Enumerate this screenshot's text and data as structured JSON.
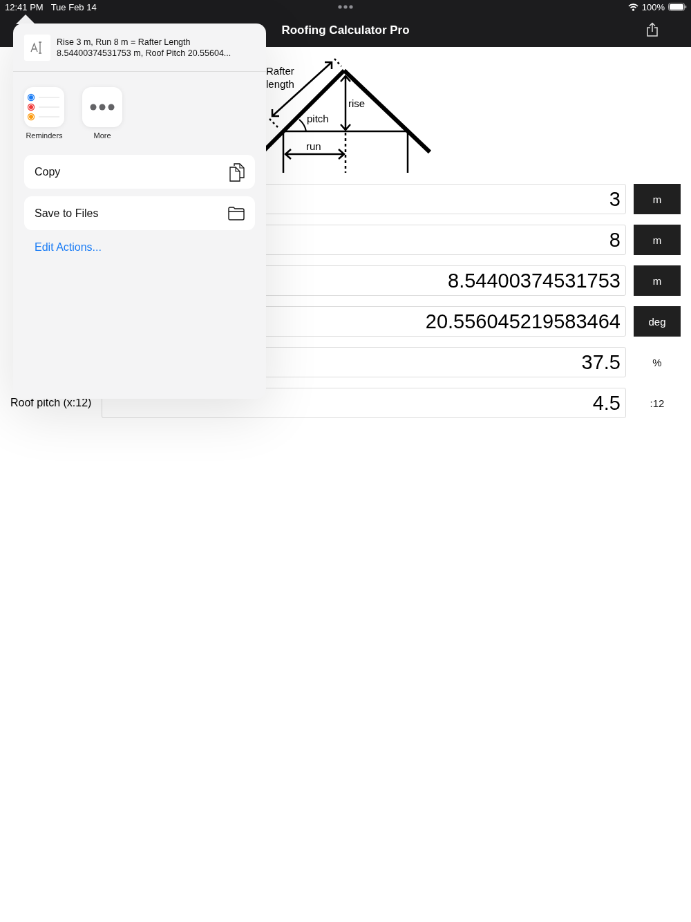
{
  "status_bar": {
    "time": "12:41 PM",
    "date": "Tue Feb 14",
    "battery": "100%"
  },
  "nav_bar": {
    "title": "Roofing Calculator Pro"
  },
  "diagram": {
    "rafter_label": [
      "Rafter",
      "length"
    ],
    "rise_label": "rise",
    "pitch_label": "pitch",
    "run_label": "run"
  },
  "rows": [
    {
      "value": "3",
      "unit": "m",
      "kind": "button"
    },
    {
      "value": "8",
      "unit": "m",
      "kind": "button"
    },
    {
      "value": "8.54400374531753",
      "unit": "m",
      "kind": "button"
    },
    {
      "value": "20.556045219583464",
      "unit": "deg",
      "kind": "button"
    },
    {
      "value": "37.5",
      "unit": "%",
      "kind": "text"
    },
    {
      "label": "Roof pitch (x:12)",
      "value": "4.5",
      "unit": ":12",
      "kind": "text"
    }
  ],
  "share_sheet": {
    "preview_lines": [
      "Rise 3 m, Run 8 m = Rafter Length",
      "8.54400374531753 m, Roof Pitch 20.55604..."
    ],
    "apps": [
      {
        "label": "Reminders",
        "kind": "reminders"
      },
      {
        "label": "More",
        "kind": "more"
      }
    ],
    "actions": [
      {
        "label": "Copy",
        "kind": "copy"
      },
      {
        "label": "Save to Files",
        "kind": "folder"
      }
    ],
    "edit_link": "Edit Actions..."
  }
}
